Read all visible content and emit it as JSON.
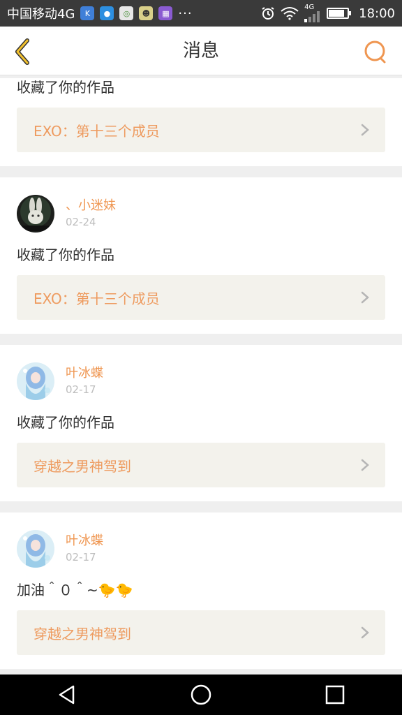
{
  "statusbar": {
    "carrier": "中国移动4G",
    "network": "4G",
    "time": "18:00",
    "battery_level": 0.85,
    "apps": [
      {
        "name": "k-app-icon",
        "glyph": "K",
        "color": "#3f7fd8"
      },
      {
        "name": "chat-app-icon",
        "glyph": "●",
        "color": "#2d8fe0"
      },
      {
        "name": "chrome-app-icon",
        "glyph": "◎",
        "color": "#e7e7e7"
      },
      {
        "name": "game-app-icon",
        "glyph": "☻",
        "color": "#d9d08a"
      },
      {
        "name": "keyboard-app-icon",
        "glyph": "▦",
        "color": "#8a5bd1"
      }
    ],
    "overflow": "···"
  },
  "header": {
    "title": "消息"
  },
  "colors": {
    "accent": "#ef9651",
    "work_text": "#ee9b5f",
    "work_bg": "#f3f2ec"
  },
  "cards": [
    {
      "message": "收藏了你的作品",
      "work_title": "EXO：第十三个成员"
    },
    {
      "username": "、小迷妹",
      "date": "02-24",
      "message": "收藏了你的作品",
      "work_title": "EXO：第十三个成员"
    },
    {
      "username": "叶冰蝶",
      "date": "02-17",
      "message": "收藏了你的作品",
      "work_title": "穿越之男神驾到"
    },
    {
      "username": "叶冰蝶",
      "date": "02-17",
      "message": "加油＾０＾~🐤🐤",
      "work_title": "穿越之男神驾到"
    }
  ]
}
